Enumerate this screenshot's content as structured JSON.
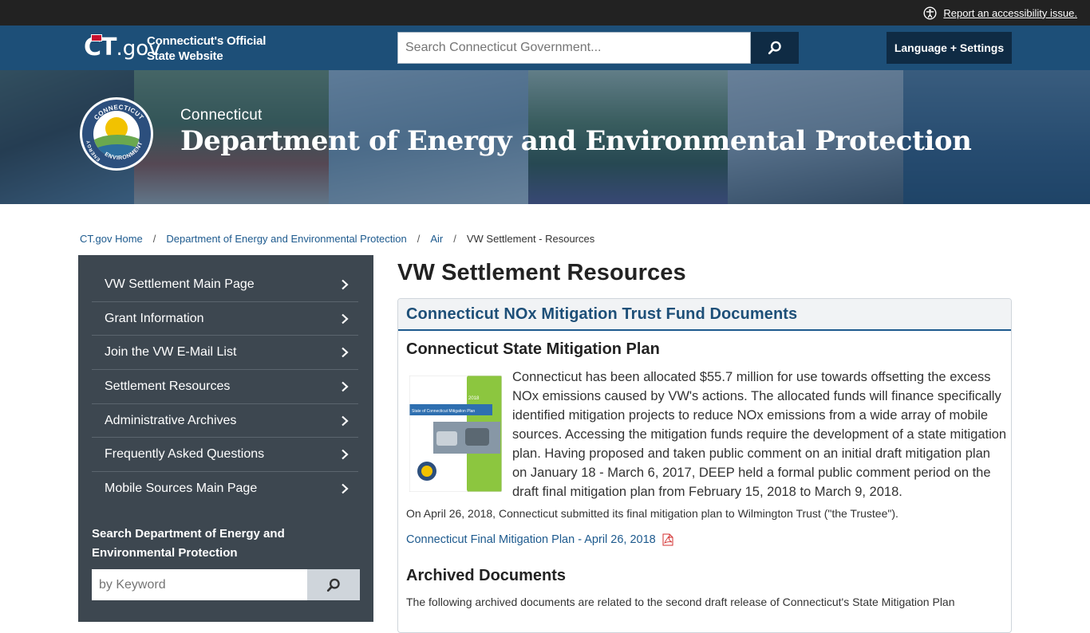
{
  "utility": {
    "accessibility_link": "Report an accessibility issue."
  },
  "header": {
    "logo_ct": "CT",
    "logo_gov": ".gov",
    "official_line1": "Connecticut's Official",
    "official_line2": "State Website",
    "search_placeholder": "Search Connecticut Government...",
    "language_button": "Language + Settings"
  },
  "banner": {
    "state": "Connecticut",
    "agency": "Department of Energy and Environmental Protection",
    "seal_top": "CONNECTICUT",
    "seal_left": "ENERGY",
    "seal_bottom": "ENVIRONMENT"
  },
  "breadcrumb": {
    "items": [
      {
        "label": "CT.gov Home"
      },
      {
        "label": "Department of Energy and Environmental Protection"
      },
      {
        "label": "Air"
      }
    ],
    "current": "VW Settlement - Resources",
    "separator": "/"
  },
  "sidebar": {
    "items": [
      {
        "label": "VW Settlement Main Page"
      },
      {
        "label": "Grant Information"
      },
      {
        "label": "Join the VW E-Mail List"
      },
      {
        "label": "Settlement Resources"
      },
      {
        "label": "Administrative Archives"
      },
      {
        "label": "Frequently Asked Questions"
      },
      {
        "label": "Mobile Sources Main Page"
      }
    ],
    "search_title": "Search Department of Energy and Environmental Protection",
    "search_placeholder": "by Keyword"
  },
  "main": {
    "title": "VW Settlement Resources",
    "card_title": "Connecticut NOx Mitigation Trust Fund Documents",
    "plan_heading": "Connecticut State Mitigation Plan",
    "cover_year": "2018",
    "cover_title": "State of Connecticut Mitigation Plan",
    "plan_text": "Connecticut has been allocated $55.7 million for use towards offsetting the excess NOx emissions caused by VW's actions. The allocated funds will finance specifically identified mitigation projects to reduce NOx emissions from a wide array of mobile sources. Accessing the mitigation funds require the development of a state mitigation plan. Having proposed and taken public comment on an initial draft mitigation plan on January 18 - March 6, 2017, DEEP held a formal public comment period on the draft final mitigation plan from February 15, 2018 to March 9, 2018.",
    "submit_text": "On April 26, 2018, Connecticut submitted its final mitigation plan to Wilmington Trust (\"the Trustee\").",
    "doc_link": "Connecticut Final Mitigation Plan - April 26, 2018",
    "archive_heading": "Archived Documents",
    "archive_text": "The following archived documents are related to the second draft release of Connecticut's State Mitigation Plan"
  },
  "colors": {
    "header_blue": "#1d4f78",
    "dark_navy": "#0f2b44",
    "sidebar_gray": "#3d4750",
    "link_blue": "#1d5a8e",
    "pdf_red": "#d32f2f"
  }
}
